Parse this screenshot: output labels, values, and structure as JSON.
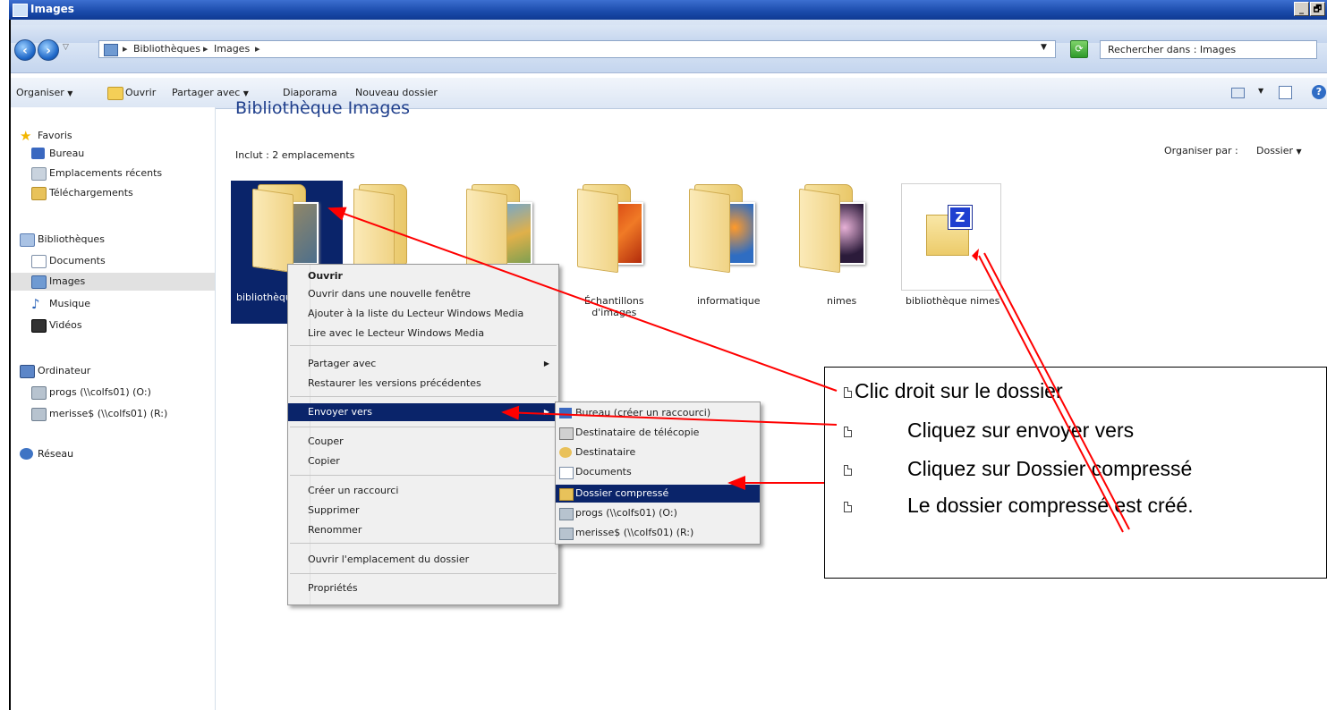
{
  "window": {
    "title": "Images",
    "min_label": "_",
    "max_label": "🗗"
  },
  "address": {
    "crumbs": [
      "Bibliothèques",
      "Images"
    ],
    "search_placeholder": "Rechercher dans : Images"
  },
  "toolbar": {
    "organize": "Organiser",
    "open": "Ouvrir",
    "share": "Partager avec",
    "slideshow": "Diaporama",
    "new_folder": "Nouveau dossier"
  },
  "sidebar": {
    "favorites": "Favoris",
    "fav_items": [
      "Bureau",
      "Emplacements récents",
      "Téléchargements"
    ],
    "libraries": "Bibliothèques",
    "lib_items": [
      "Documents",
      "Images",
      "Musique",
      "Vidéos"
    ],
    "computer": "Ordinateur",
    "computer_items": [
      "progs (\\\\colfs01) (O:)",
      "merisse$ (\\\\colfs01) (R:)"
    ],
    "network": "Réseau"
  },
  "library": {
    "title": "Bibliothèque Images",
    "includes": "Inclut :  2 emplacements",
    "arrange_label": "Organiser par :",
    "arrange_value": "Dossier"
  },
  "tiles": [
    {
      "label": "bibliothèqu"
    },
    {
      "label": ""
    },
    {
      "label": ""
    },
    {
      "label": "Échantillons\nd'images"
    },
    {
      "label": "informatique"
    },
    {
      "label": "nimes"
    },
    {
      "label": "bibliothèque nimes"
    }
  ],
  "context_menu": {
    "items": [
      "Ouvrir",
      "Ouvrir dans une nouvelle fenêtre",
      "Ajouter à la liste du Lecteur Windows Media",
      "Lire avec le Lecteur Windows Media",
      "Partager avec",
      "Restaurer les versions précédentes",
      "Envoyer vers",
      "Couper",
      "Copier",
      "Créer un raccourci",
      "Supprimer",
      "Renommer",
      "Ouvrir l'emplacement du dossier",
      "Propriétés"
    ]
  },
  "send_to_menu": {
    "items": [
      "Bureau (créer un raccourci)",
      "Destinataire de télécopie",
      "Destinataire",
      "Documents",
      "Dossier compressé",
      "progs (\\\\colfs01) (O:)",
      "merisse$ (\\\\colfs01) (R:)"
    ]
  },
  "callout": {
    "lines": [
      "Clic droit sur le dossier",
      "Cliquez sur envoyer vers",
      "Cliquez sur Dossier compressé",
      "Le dossier compressé est créé."
    ]
  },
  "colors": {
    "arrow": "#ff0000",
    "highlight": "#0a246a",
    "title_blue": "#1f3f8c"
  }
}
